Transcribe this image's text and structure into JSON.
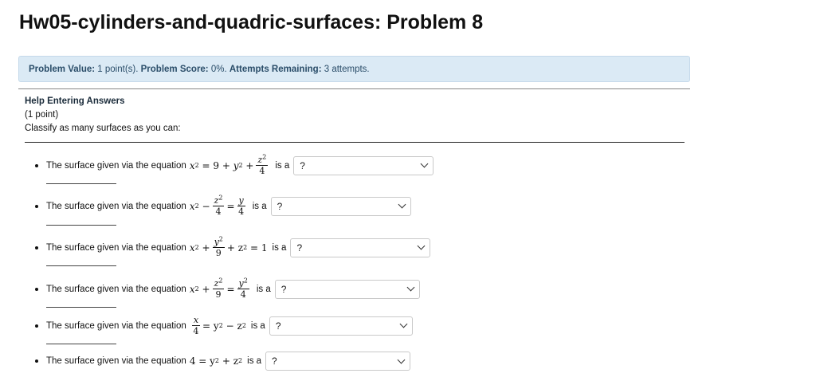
{
  "page": {
    "title": "Hw05-cylinders-and-quadric-surfaces: Problem 8"
  },
  "info": {
    "value_label": "Problem Value:",
    "value_text": "1 point(s).",
    "score_label": "Problem Score:",
    "score_text": "0%.",
    "attempts_label": "Attempts Remaining:",
    "attempts_text": "3 attempts."
  },
  "help": {
    "link_text": "Help Entering Answers",
    "points": "(1 point)",
    "intro": "Classify as many surfaces as you can:"
  },
  "questions": [
    {
      "prefix": "The surface given via the equation",
      "suffix": "is a",
      "selected": "?"
    },
    {
      "prefix": "The surface given via the equation",
      "suffix": "is a",
      "selected": "?"
    },
    {
      "prefix": "The surface given via the equation",
      "suffix": "is a",
      "selected": "?"
    },
    {
      "prefix": "The surface given via the equation",
      "suffix": "is a",
      "selected": "?"
    },
    {
      "prefix": "The surface given via the equation",
      "suffix": "is a",
      "selected": "?"
    },
    {
      "prefix": "The surface given via the equation",
      "suffix": "is a",
      "selected": "?"
    }
  ],
  "math": {
    "eq1": {
      "lhs": "x",
      "exp": "2",
      "mid": "= 9 +",
      "y": "y",
      "plus": "+",
      "num_var": "z",
      "den": "4"
    },
    "eq2": {
      "lhs": "x",
      "exp": "2",
      "minus": "−",
      "num_var": "z",
      "den": "4",
      "eq": "=",
      "num2": "y",
      "den2": "4"
    },
    "eq3": {
      "lhs": "x",
      "exp": "2",
      "plus": "+",
      "num_var": "y",
      "den": "9",
      "tail": "+ z",
      "end": "= 1"
    },
    "eq4": {
      "lhs": "x",
      "exp": "2",
      "plus": "+",
      "num_var": "z",
      "den": "9",
      "eq": "=",
      "num2": "y",
      "den2": "4"
    },
    "eq5": {
      "num": "x",
      "den": "4",
      "rest": "= y",
      "minus": "− z"
    },
    "eq6": {
      "lead": "4 = y",
      "plus": "+ z"
    }
  }
}
